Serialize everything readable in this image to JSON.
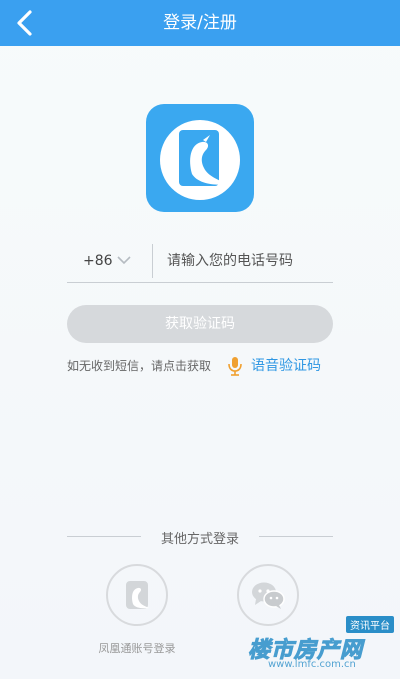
{
  "header": {
    "title": "登录/注册"
  },
  "phone": {
    "country_code": "+86",
    "placeholder": "请输入您的电话号码"
  },
  "get_code_button": "获取验证码",
  "hint": {
    "text": "如无收到短信，请点击获取",
    "voice_link": "语音验证码"
  },
  "other_login": {
    "title": "其他方式登录",
    "options": [
      {
        "label": "凤凰通账号登录",
        "icon": "phoenix-icon"
      },
      {
        "label": "",
        "icon": "wechat-icon"
      }
    ]
  },
  "watermark": {
    "line1": "资讯平台",
    "line2": "楼市房产网",
    "line3": "www.lmfc.com.cn"
  },
  "colors": {
    "accent": "#3aa0f0",
    "link": "#2f97e3",
    "mic": "#f0a030",
    "disabled_button": "#d6d9dc"
  }
}
